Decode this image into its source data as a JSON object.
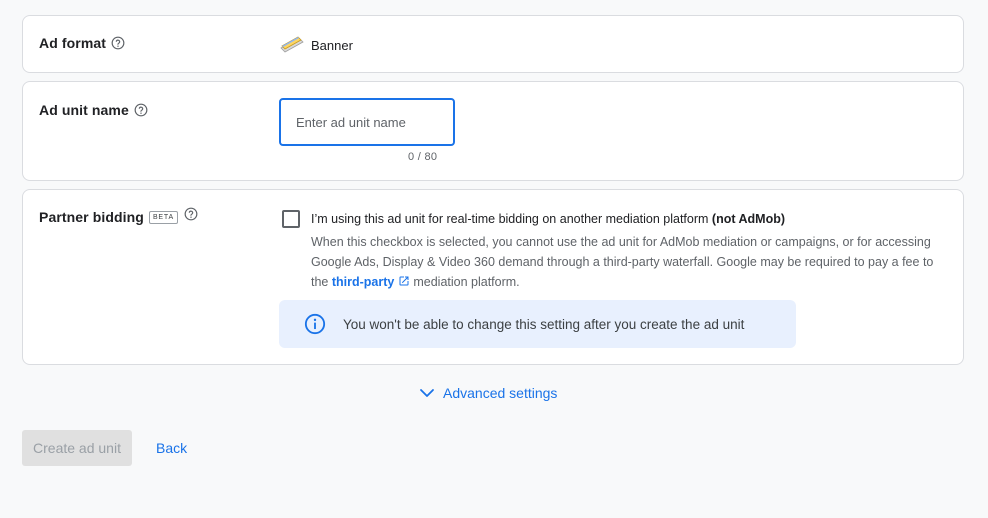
{
  "ad_format": {
    "label": "Ad format",
    "value": "Banner",
    "icon": "banner-icon"
  },
  "ad_unit_name": {
    "label": "Ad unit name",
    "placeholder": "Enter ad unit name",
    "value": "",
    "char_count": "0 / 80"
  },
  "partner_bidding": {
    "label": "Partner bidding",
    "badge": "BETA",
    "checked": false,
    "checkbox_label": "I’m using this ad unit for real-time bidding on another mediation platform ",
    "checkbox_label_bold": "(not AdMob)",
    "description_1": "When this checkbox is selected, you cannot use the ad unit for AdMob mediation or campaigns, or for accessing Google Ads, Display & Video 360 demand through a third-party waterfall. Google may be required to pay a fee to the ",
    "link_text": "third-party",
    "description_2": "mediation platform.",
    "info_text": "You won't be able to change this setting after you create the ad unit"
  },
  "advanced_settings": {
    "label": "Advanced settings"
  },
  "actions": {
    "create_label": "Create ad unit",
    "back_label": "Back"
  },
  "colors": {
    "accent": "#1a73e8",
    "info_bg": "#e8f0fe",
    "disabled_bg": "#e0e0e0",
    "border": "#dadce0"
  }
}
